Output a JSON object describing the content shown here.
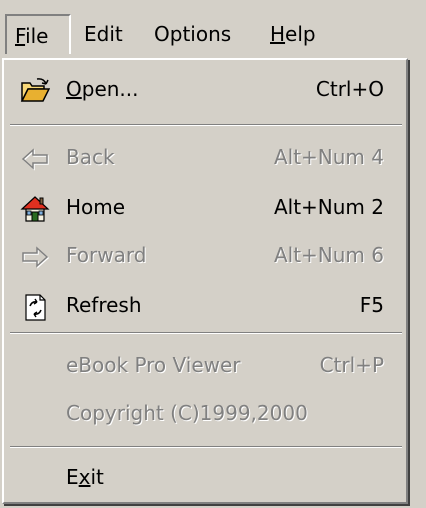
{
  "menubar": {
    "file": {
      "pre": "",
      "ul": "F",
      "post": "ile"
    },
    "edit": {
      "pre": "",
      "ul": "",
      "post": "Edit"
    },
    "options": {
      "pre": "",
      "ul": "",
      "post": "Options"
    },
    "help": {
      "pre": "",
      "ul": "H",
      "post": "elp"
    }
  },
  "file_menu": {
    "open": {
      "ul": "O",
      "post": "pen...",
      "shortcut": "Ctrl+O",
      "icon": "open-folder-icon",
      "enabled": true
    },
    "back": {
      "label": "Back",
      "shortcut": "Alt+Num 4",
      "icon": "back-arrow-icon",
      "enabled": false
    },
    "home": {
      "label": "Home",
      "shortcut": "Alt+Num 2",
      "icon": "home-icon",
      "enabled": true
    },
    "forward": {
      "label": "Forward",
      "shortcut": "Alt+Num 6",
      "icon": "forward-arrow-icon",
      "enabled": false
    },
    "refresh": {
      "label": "Refresh",
      "shortcut": "F5",
      "icon": "refresh-icon",
      "enabled": true
    },
    "ebook": {
      "label": "eBook Pro Viewer",
      "shortcut": "Ctrl+P",
      "enabled": false
    },
    "copyright": {
      "label": "Copyright (C)1999,2000",
      "enabled": false
    },
    "exit": {
      "pre": "E",
      "ul": "x",
      "post": "it",
      "enabled": true
    }
  },
  "colors": {
    "face": "#d4d0c8",
    "highlight": "#ffffff",
    "shadow": "#808080",
    "text": "#000000",
    "disabled_text": "#808080"
  }
}
